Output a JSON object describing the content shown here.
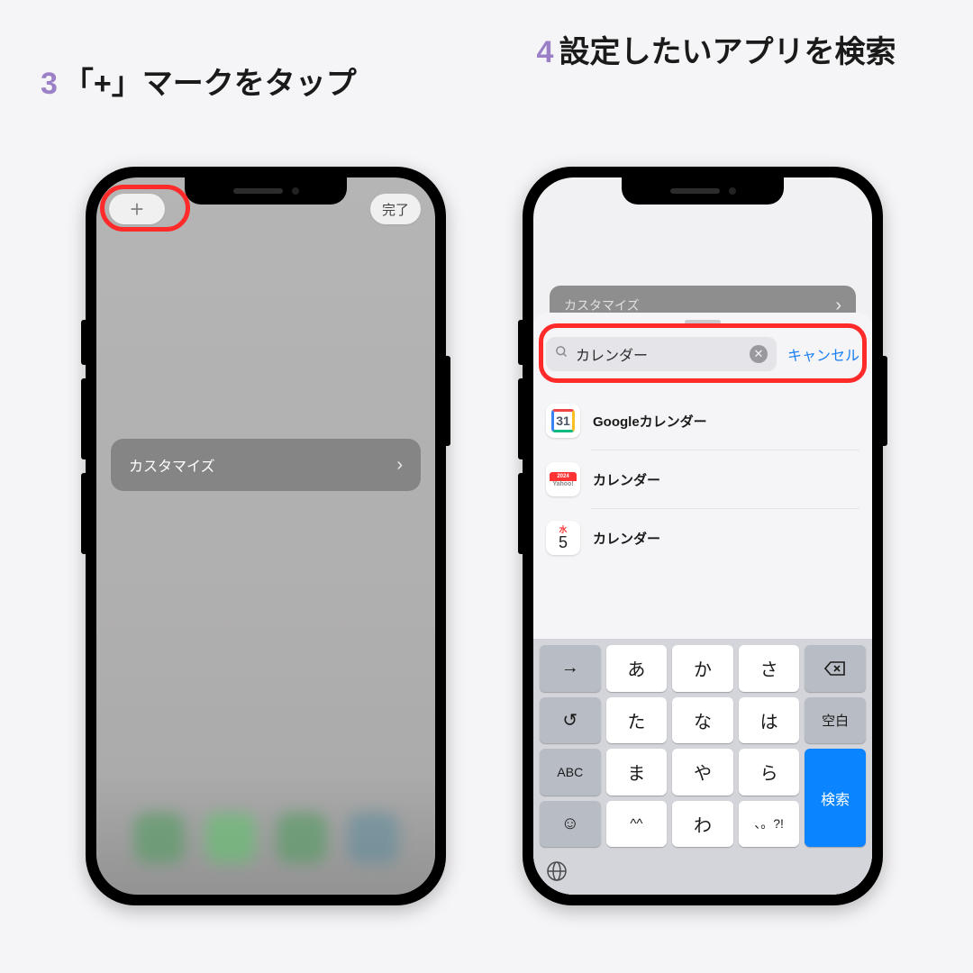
{
  "instructions": {
    "step3": {
      "number": "3",
      "text": "「+」マークをタップ"
    },
    "step4": {
      "number": "4",
      "text": "設定したいアプリを検索"
    }
  },
  "screenA": {
    "plus_label": "+",
    "done_label": "完了",
    "customize_label": "カスタマイズ"
  },
  "screenB": {
    "peek_label": "カスタマイズ",
    "search_value": "カレンダー",
    "cancel_label": "キャンセル",
    "results": [
      {
        "label": "Googleカレンダー",
        "icon_text": "31",
        "icon_type": "gcal"
      },
      {
        "label": "カレンダー",
        "icon_top": "2024",
        "icon_body": "Yahoo!",
        "icon_type": "ycal"
      },
      {
        "label": "カレンダー",
        "icon_dot": "水",
        "icon_num": "5",
        "icon_type": "acal"
      }
    ]
  },
  "keyboard": {
    "rows": [
      [
        "→",
        "あ",
        "か",
        "さ",
        "⌫"
      ],
      [
        "↺",
        "た",
        "な",
        "は",
        "空白"
      ],
      [
        "ABC",
        "ま",
        "や",
        "ら",
        "検索"
      ],
      [
        "☺",
        "^^",
        "わ",
        "、。?!",
        ""
      ]
    ],
    "globe": "🌐"
  }
}
